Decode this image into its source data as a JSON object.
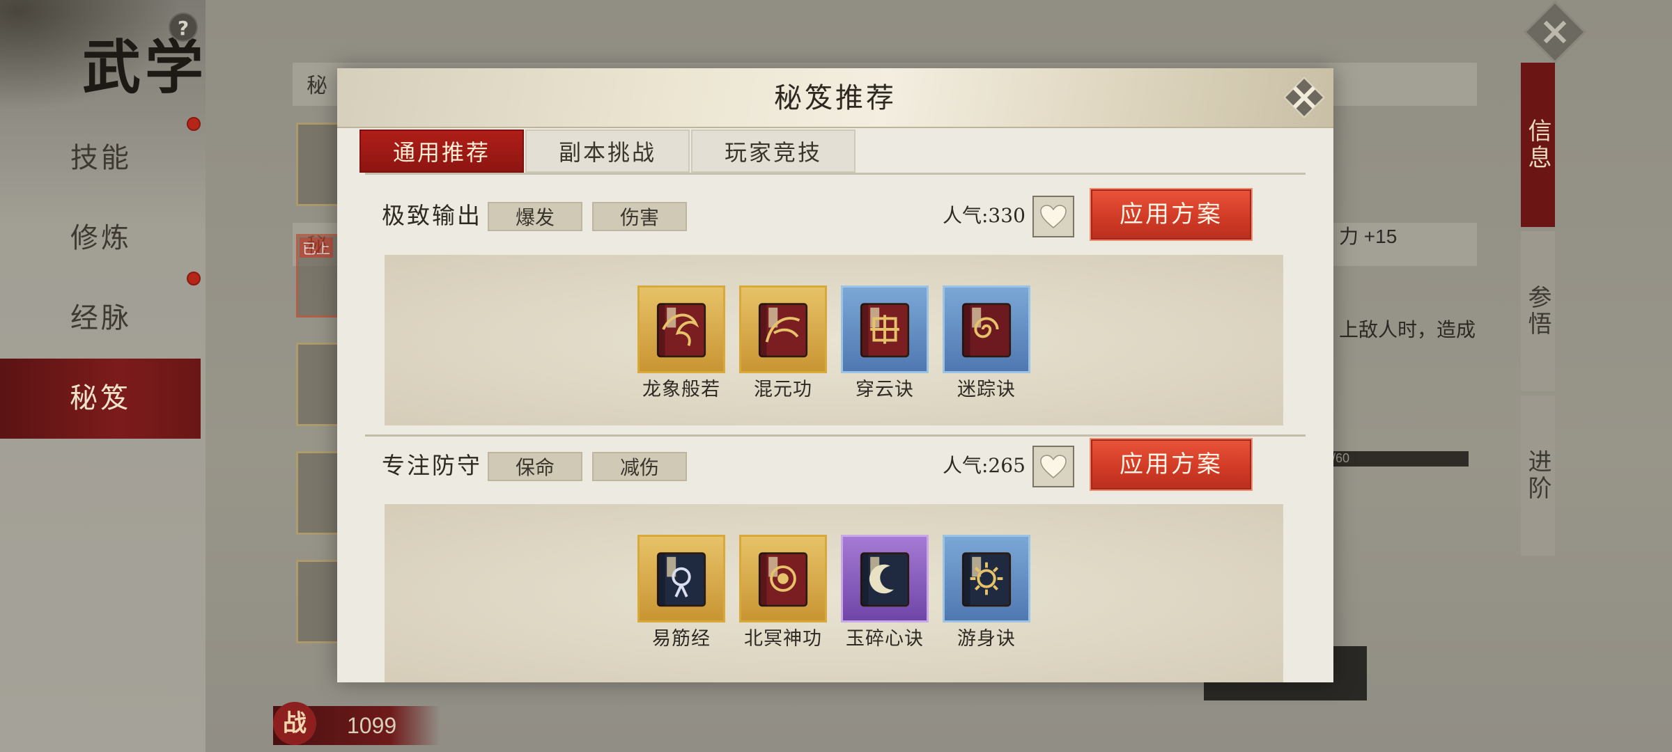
{
  "background": {
    "title": "武学",
    "help_label": "?",
    "menu": [
      {
        "label": "技能",
        "badge": true
      },
      {
        "label": "修炼",
        "badge": false
      },
      {
        "label": "经脉",
        "badge": true
      },
      {
        "label": "秘笈",
        "badge": false,
        "active": true
      }
    ],
    "side_tabs": [
      {
        "label": "信息",
        "active": true
      },
      {
        "label": "参悟",
        "active": false
      },
      {
        "label": "进阶",
        "active": false
      }
    ],
    "panel_label_1": "秘",
    "panel_label_2": "秘",
    "equipped_badge": "已上",
    "right_stat": "力 +15",
    "right_desc": "上敌人时，造成",
    "right_bar_text": "/60",
    "power_icon": "战",
    "power_value": "1099"
  },
  "modal": {
    "title": "秘笈推荐",
    "tabs": [
      {
        "label": "通用推荐",
        "active": true
      },
      {
        "label": "副本挑战",
        "active": false
      },
      {
        "label": "玩家竞技",
        "active": false
      }
    ],
    "sections": [
      {
        "name": "极致输出",
        "tags": [
          "爆发",
          "伤害"
        ],
        "popularity": "人气:330",
        "apply_label": "应用方案",
        "books": [
          {
            "name": "龙象般若",
            "rarity": "gold",
            "cover": "#7a1e22",
            "emblem": "dragon-icon"
          },
          {
            "name": "混元功",
            "rarity": "gold",
            "cover": "#7a1e22",
            "emblem": "phoenix-icon"
          },
          {
            "name": "穿云诀",
            "rarity": "blue",
            "cover": "#7a1e22",
            "emblem": "knot-icon"
          },
          {
            "name": "迷踪诀",
            "rarity": "blue",
            "cover": "#6c1a20",
            "emblem": "spiral-icon"
          }
        ]
      },
      {
        "name": "专注防守",
        "tags": [
          "保命",
          "减伤"
        ],
        "popularity": "人气:265",
        "apply_label": "应用方案",
        "books": [
          {
            "name": "易筋经",
            "rarity": "gold",
            "cover": "#1f2a40",
            "emblem": "ribbon-icon"
          },
          {
            "name": "北冥神功",
            "rarity": "gold",
            "cover": "#7a1e22",
            "emblem": "seal-icon"
          },
          {
            "name": "玉碎心诀",
            "rarity": "purple",
            "cover": "#1f2a40",
            "emblem": "moon-icon"
          },
          {
            "name": "游身诀",
            "rarity": "blue",
            "cover": "#1f2a40",
            "emblem": "sun-icon"
          }
        ]
      }
    ]
  },
  "colors": {
    "accent_red": "#b01e18",
    "apply_orange": "#d23b26",
    "gold_frame": "#d8a93a",
    "blue_frame": "#9cc3e4",
    "purple_frame": "#c8a9e8"
  }
}
